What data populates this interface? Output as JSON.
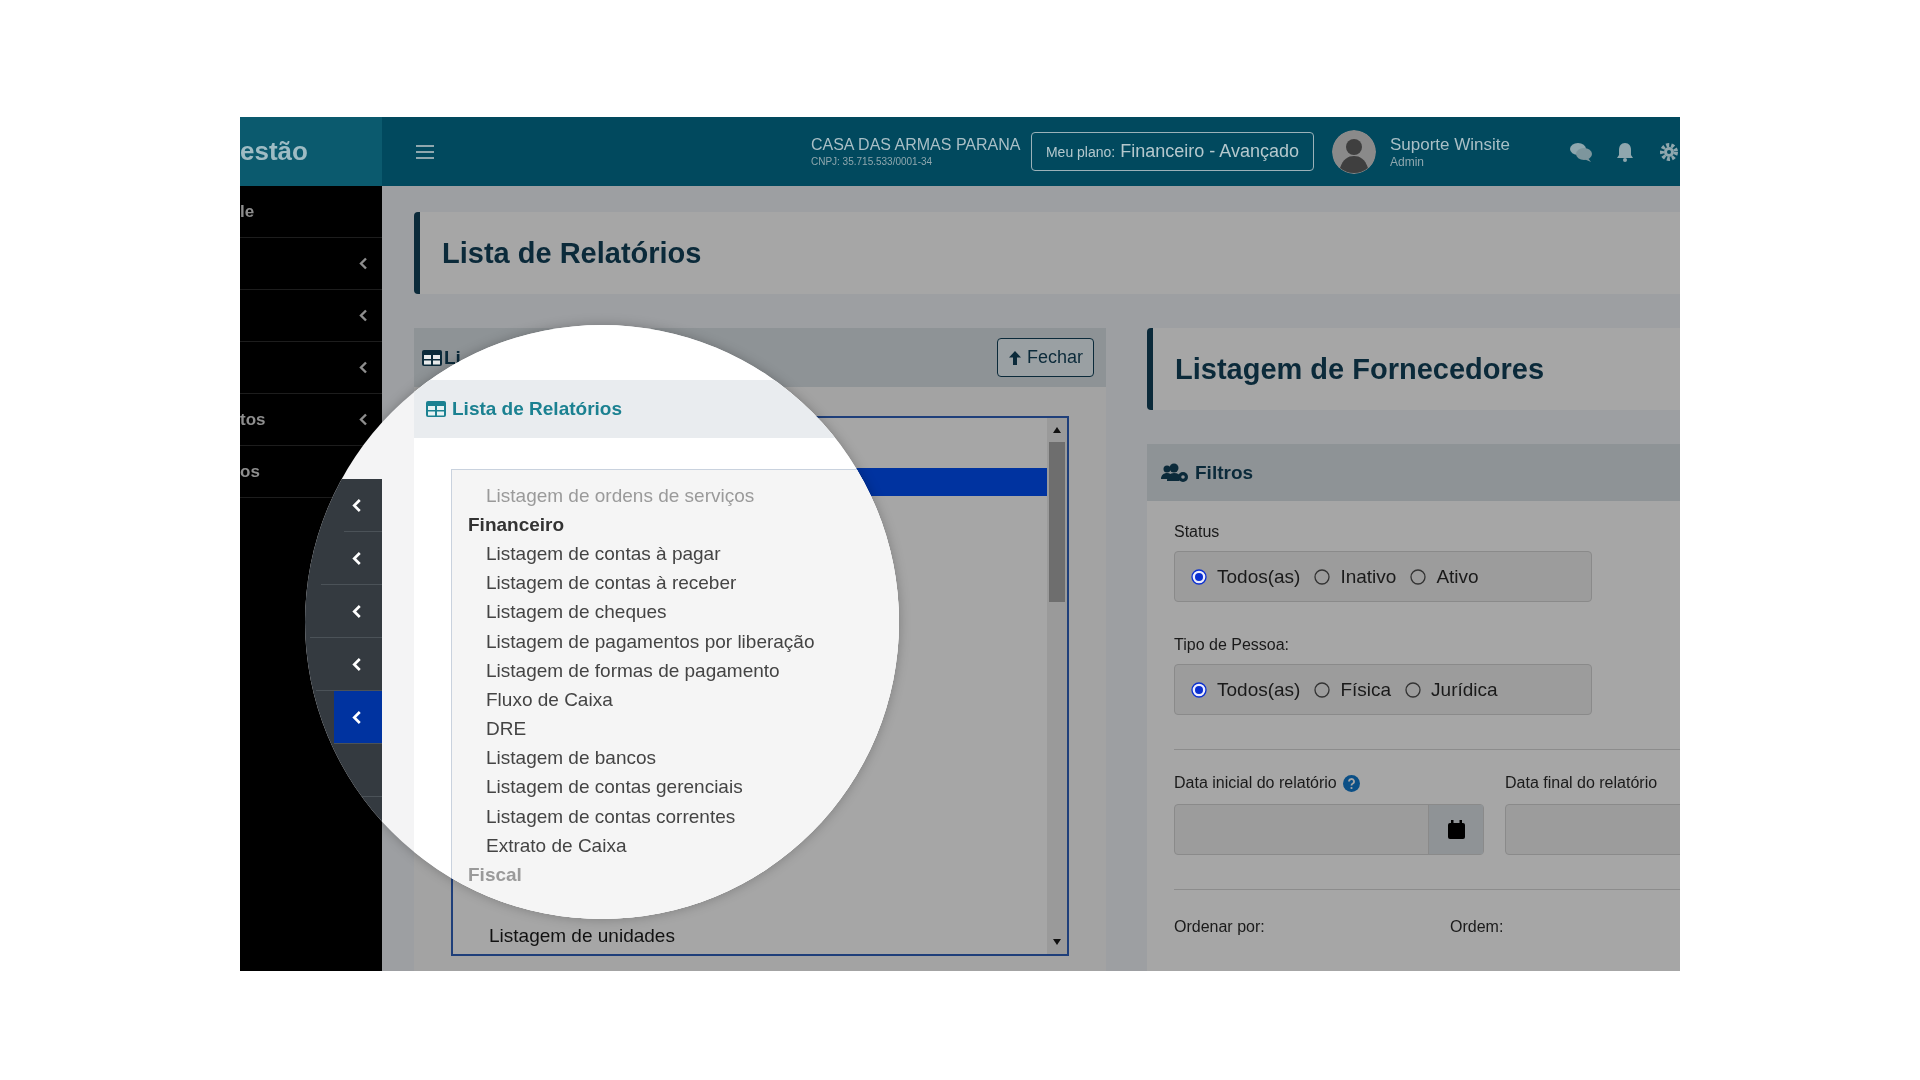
{
  "sidebar": {
    "brand": "estão",
    "items": [
      {
        "kind": "label",
        "label": "le"
      },
      {
        "kind": "chevron"
      },
      {
        "kind": "chevron"
      },
      {
        "kind": "chevron"
      },
      {
        "kind": "label_chevron",
        "label": "tos"
      },
      {
        "kind": "label",
        "label": "os"
      }
    ]
  },
  "header": {
    "company": "CASA DAS ARMAS PARANA",
    "cnpj": "CNPJ: 35.715.533/0001-34",
    "plan_label": "Meu plano:",
    "plan_name": "Financeiro - Avançado",
    "user": {
      "name": "Suporte Winsite",
      "role": "Admin"
    }
  },
  "page_title": "Lista de Relatórios",
  "reports_panel": {
    "title": "Li",
    "close_button": "Fechar",
    "list_rows": [
      {
        "selected": true
      },
      {
        "text": "Listagem de unidades",
        "selected": false
      }
    ]
  },
  "magnifier": {
    "sidebar_rows": [
      {
        "selected": false
      },
      {
        "selected": false
      },
      {
        "selected": false
      },
      {
        "selected": false
      },
      {
        "selected": true
      },
      {
        "selected": false
      }
    ],
    "panel_title": "Lista de Relatórios",
    "entries": [
      {
        "kind": "item",
        "text": "Listagem de ordens de serviços",
        "faded": true
      },
      {
        "kind": "group",
        "text": "Financeiro",
        "faded": false
      },
      {
        "kind": "item",
        "text": "Listagem de contas à pagar",
        "faded": false
      },
      {
        "kind": "item",
        "text": "Listagem de contas à receber",
        "faded": false
      },
      {
        "kind": "item",
        "text": "Listagem de cheques",
        "faded": false
      },
      {
        "kind": "item",
        "text": "Listagem de pagamentos por liberação",
        "faded": false
      },
      {
        "kind": "item",
        "text": "Listagem de formas de pagamento",
        "faded": false
      },
      {
        "kind": "item",
        "text": "Fluxo de Caixa",
        "faded": false
      },
      {
        "kind": "item",
        "text": "DRE",
        "faded": false
      },
      {
        "kind": "item",
        "text": "Listagem de bancos",
        "faded": false
      },
      {
        "kind": "item",
        "text": "Listagem de contas gerenciais",
        "faded": false
      },
      {
        "kind": "item",
        "text": "Listagem de contas correntes",
        "faded": false
      },
      {
        "kind": "item",
        "text": "Extrato de Caixa",
        "faded": false
      },
      {
        "kind": "group",
        "text": "Fiscal",
        "faded": true
      }
    ]
  },
  "detail": {
    "title": "Listagem de Fornecedores",
    "filters": {
      "title": "Filtros",
      "groups": [
        {
          "label": "Status",
          "options": [
            {
              "label": "Todos(as)",
              "selected": true
            },
            {
              "label": "Inativo",
              "selected": false
            },
            {
              "label": "Ativo",
              "selected": false
            }
          ]
        },
        {
          "label": "Tipo de Pessoa:",
          "options": [
            {
              "label": "Todos(as)",
              "selected": true
            },
            {
              "label": "Física",
              "selected": false
            },
            {
              "label": "Jurídica",
              "selected": false
            }
          ]
        }
      ],
      "date_fields": [
        {
          "label": "Data inicial do relatório",
          "help": true,
          "calendar": true
        },
        {
          "label": "Data final do relatório",
          "help": false
        }
      ],
      "sort_labels": [
        "Ordenar por:",
        "Ordem:"
      ]
    }
  }
}
